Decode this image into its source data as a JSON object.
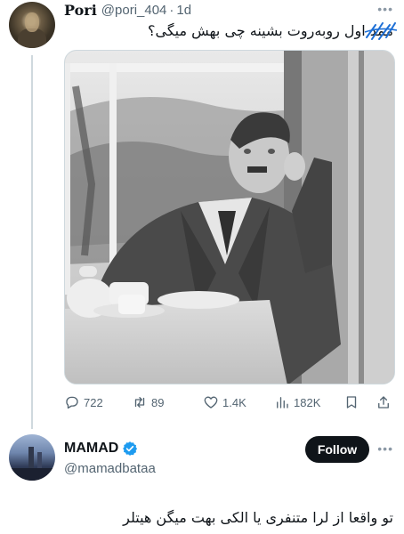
{
  "tweet1": {
    "display_name": "Pori",
    "handle": "@pori_404",
    "separator": "·",
    "time": "1d",
    "text": "ممد اول روبه‌روت بشینه چی بهش میگی؟",
    "actions": {
      "replies": "722",
      "retweets": "89",
      "likes": "1.4K",
      "views": "182K"
    }
  },
  "tweet2": {
    "display_name": "MAMAD",
    "handle": "@mamadbataa",
    "follow_label": "Follow",
    "text": "تو واقعا از لرا متنفری یا الکی بهت میگن هیتلر"
  },
  "icons": {
    "more": "more-dots-icon",
    "reply": "reply-bubble-icon",
    "retweet": "retweet-icon",
    "like": "heart-icon",
    "views": "views-bars-icon",
    "bookmark": "bookmark-icon",
    "share": "share-upload-icon",
    "verified": "verified-badge-icon"
  },
  "colors": {
    "text": "#0f1419",
    "secondary": "#536471",
    "verified": "#1d9bf0",
    "follow_bg": "#0f1419",
    "divider": "#cfd9de"
  }
}
